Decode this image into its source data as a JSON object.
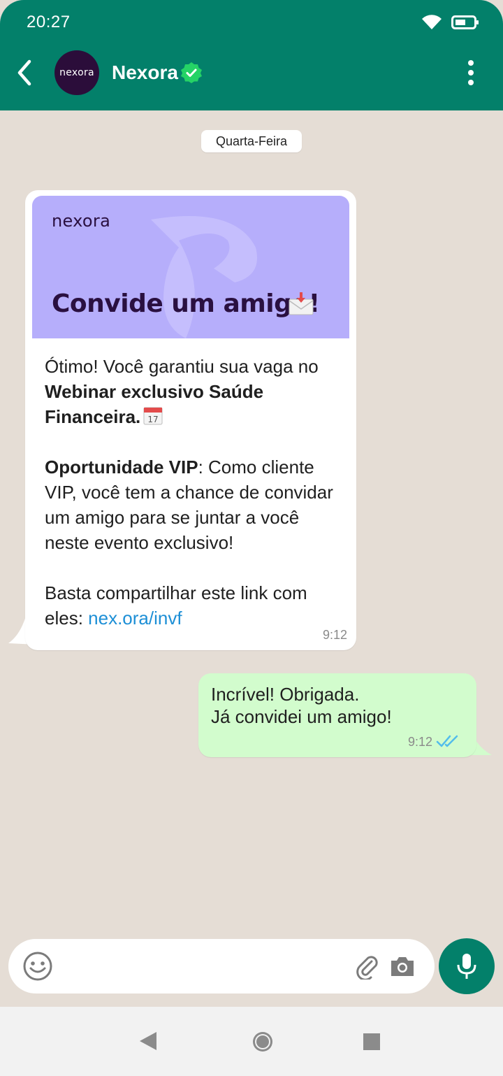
{
  "status_bar": {
    "time": "20:27"
  },
  "header": {
    "contact_name": "Nexora",
    "avatar_text": "nexora",
    "accent_color": "#03806a"
  },
  "chat": {
    "date_label": "Quarta-Feira",
    "incoming": {
      "banner_logo": "nexora",
      "banner_title": "Convide um amigo!",
      "banner_color": "#b6aefb",
      "line1": "Ótimo! Você garantiu sua vaga no",
      "bold1": "Webinar exclusivo Saúde Financeira.",
      "bold2": "Oportunidade VIP",
      "line2": ": Como cliente VIP, você tem a chance de convidar um amigo para se juntar a você neste evento exclusivo!",
      "line3": "Basta compartilhar este link com eles: ",
      "link": "nex.ora/invf",
      "time": "9:12"
    },
    "outgoing": {
      "text": "Incrível! Obrigada.\nJá convidei um amigo!",
      "time": "9:12",
      "bubble_color": "#d2fccd"
    }
  },
  "composer": {
    "icons": [
      "emoji-icon",
      "paperclip-icon",
      "camera-icon",
      "microphone-icon"
    ]
  },
  "nav": {
    "icons": [
      "back-triangle-icon",
      "home-circle-icon",
      "recent-square-icon"
    ]
  }
}
